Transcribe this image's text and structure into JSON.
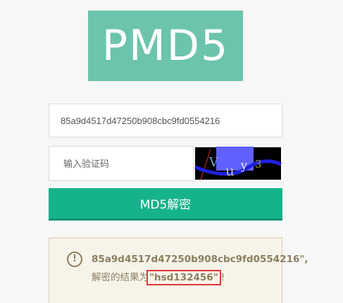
{
  "logo": {
    "text": "PMD5"
  },
  "hash_field": {
    "value": "85a9d4517d47250b908cbc9fd0554216"
  },
  "captcha_field": {
    "placeholder": "输入验证码",
    "value": ""
  },
  "captcha_image": {
    "chars": [
      "V",
      "u",
      "y",
      "3"
    ]
  },
  "submit": {
    "label": "MD5解密"
  },
  "result": {
    "icon": "info-icon",
    "hash_text": "85a9d4517d47250b908cbc9fd0554216",
    "hash_suffix": "\",",
    "prefix": "解密的结果为",
    "plaintext_quoted": "\"hsd132456\"",
    "suffix": "!"
  },
  "colors": {
    "logo_bg": "#6cc4ad",
    "button_bg": "#15b38c",
    "result_bg": "#f6f3e9",
    "result_text": "#8c7f60",
    "highlight_border": "#e03a3a"
  }
}
